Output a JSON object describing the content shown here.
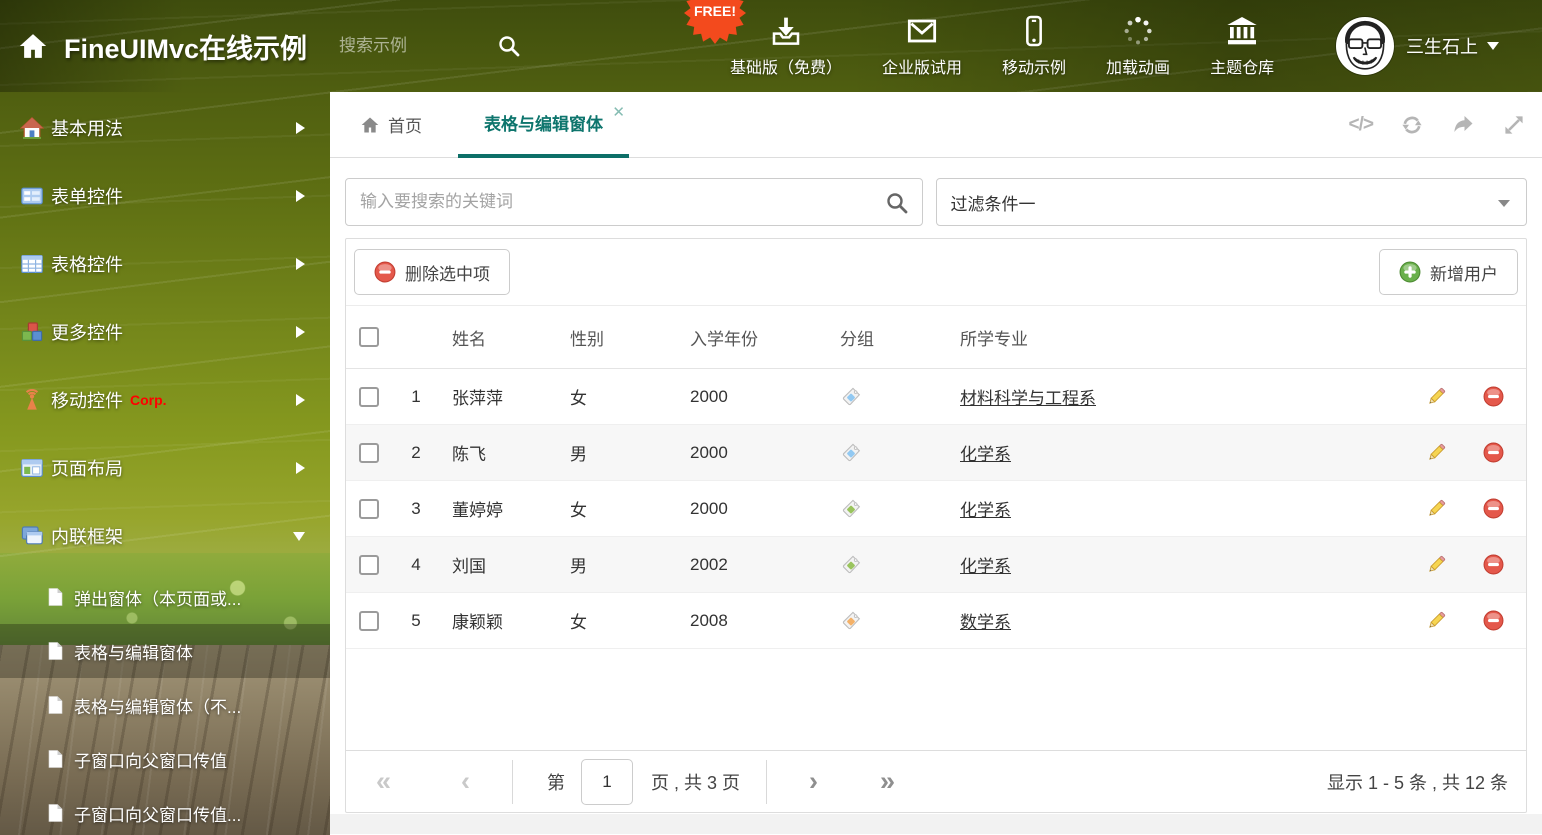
{
  "header": {
    "title": "FineUIMvc在线示例",
    "search_placeholder": "搜索示例",
    "free_badge": "FREE!",
    "nav": [
      {
        "label": "基础版（免费）",
        "icon": "download-icon"
      },
      {
        "label": "企业版试用",
        "icon": "envelope-icon"
      },
      {
        "label": "移动示例",
        "icon": "mobile-icon"
      },
      {
        "label": "加载动画",
        "icon": "spinner-icon"
      },
      {
        "label": "主题仓库",
        "icon": "bank-icon"
      }
    ],
    "username": "三生石上"
  },
  "sidebar": {
    "items": [
      {
        "label": "基本用法",
        "icon": "home-icon"
      },
      {
        "label": "表单控件",
        "icon": "form-icon"
      },
      {
        "label": "表格控件",
        "icon": "grid-icon"
      },
      {
        "label": "更多控件",
        "icon": "cubes-icon"
      },
      {
        "label": "移动控件",
        "icon": "antenna-icon",
        "badge": "Corp."
      },
      {
        "label": "页面布局",
        "icon": "layout-icon"
      },
      {
        "label": "内联框架",
        "icon": "frames-icon",
        "expanded": true
      }
    ],
    "submenu": [
      {
        "label": "弹出窗体（本页面或..."
      },
      {
        "label": "表格与编辑窗体",
        "selected": true
      },
      {
        "label": "表格与编辑窗体（不..."
      },
      {
        "label": "子窗口向父窗口传值"
      },
      {
        "label": "子窗口向父窗口传值..."
      }
    ]
  },
  "tabbar": {
    "home_tab": "首页",
    "active_tab": "表格与编辑窗体",
    "close_glyph": "✕"
  },
  "filters": {
    "search_placeholder": "输入要搜索的关键词",
    "filter_value": "过滤条件一"
  },
  "toolbar": {
    "delete_label": "删除选中项",
    "add_label": "新增用户"
  },
  "table": {
    "columns": [
      "姓名",
      "性别",
      "入学年份",
      "分组",
      "所学专业"
    ],
    "rows": [
      {
        "num": "1",
        "name": "张萍萍",
        "gender": "女",
        "year": "2000",
        "tag_color": "#92c9f2",
        "major": "材料科学与工程系"
      },
      {
        "num": "2",
        "name": "陈飞",
        "gender": "男",
        "year": "2000",
        "tag_color": "#92c9f2",
        "major": "化学系"
      },
      {
        "num": "3",
        "name": "董婷婷",
        "gender": "女",
        "year": "2000",
        "tag_color": "#9ac45e",
        "major": "化学系"
      },
      {
        "num": "4",
        "name": "刘国",
        "gender": "男",
        "year": "2002",
        "tag_color": "#9ac45e",
        "major": "化学系"
      },
      {
        "num": "5",
        "name": "康颖颖",
        "gender": "女",
        "year": "2008",
        "tag_color": "#f4b168",
        "major": "数学系"
      }
    ]
  },
  "pagination": {
    "first_glyph": "«",
    "prev_glyph": "‹",
    "page_prefix": "第",
    "page_value": "1",
    "page_suffix": "页 , 共 3 页",
    "next_glyph": "›",
    "last_glyph": "»",
    "summary": "显示 1 - 5 条 , 共 12 条"
  },
  "colors": {
    "accent_teal": "#0e756d",
    "free_badge_orange": "#f34a1d",
    "corp_badge_red": "#ff0000",
    "delete_red": "#e4584b",
    "add_green": "#6ab04c",
    "tag_blue": "#92c9f2",
    "tag_green": "#9ac45e",
    "tag_orange": "#f4b168"
  }
}
